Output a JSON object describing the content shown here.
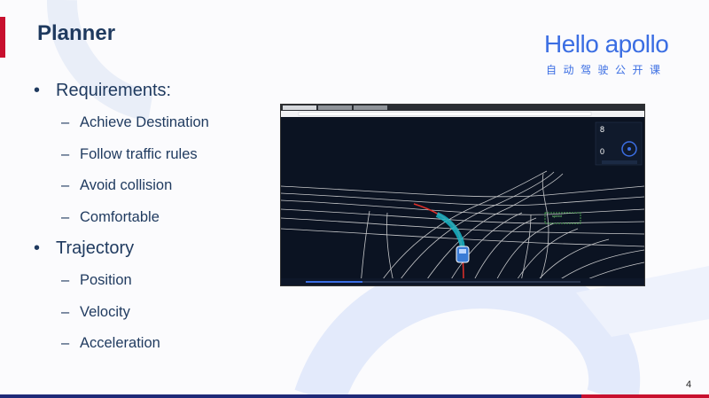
{
  "slide": {
    "title": "Planner",
    "page_number": "4"
  },
  "logo": {
    "main": "Hello apollo",
    "sub": "自动驾驶公开课",
    "color": "#3b6ee3"
  },
  "bullets": [
    {
      "text": "Requirements:",
      "items": [
        "Achieve Destination",
        "Follow traffic rules",
        "Avoid collision",
        "Comfortable"
      ]
    },
    {
      "text": "Trajectory",
      "items": [
        "Position",
        "Velocity",
        "Acceleration"
      ]
    }
  ],
  "simulation_panel": {
    "speed_value": "8",
    "accel_value": "0",
    "colors": {
      "background": "#0b1322",
      "path": "#19b8c8",
      "lanes": "#e8e8e8",
      "reference": "#e0302a"
    }
  },
  "colors": {
    "title": "#1f3a5f",
    "accent_red": "#c8102e",
    "accent_navy": "#1f2a78"
  }
}
